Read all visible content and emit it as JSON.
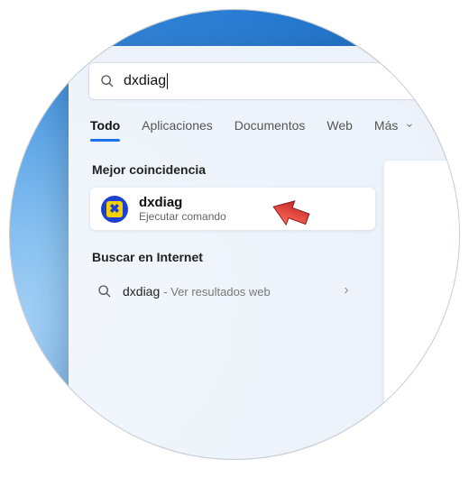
{
  "search": {
    "query": "dxdiag"
  },
  "tabs": {
    "all": "Todo",
    "apps": "Aplicaciones",
    "docs": "Documentos",
    "web": "Web",
    "more": "Más"
  },
  "sections": {
    "best_match": "Mejor coincidencia",
    "search_internet": "Buscar en Internet"
  },
  "best_match": {
    "title": "dxdiag",
    "subtitle": "Ejecutar comando"
  },
  "internet_result": {
    "query": "dxdiag",
    "suffix": " - Ver resultados web"
  }
}
